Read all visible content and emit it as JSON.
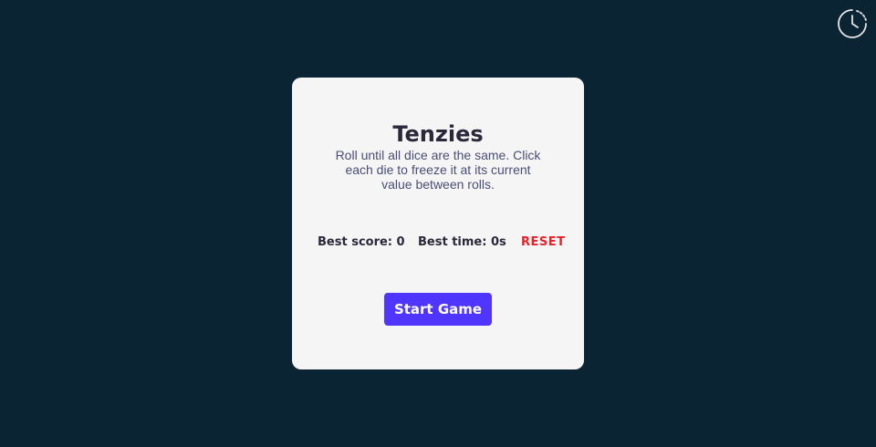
{
  "header": {
    "history_icon": "clock-history-icon"
  },
  "card": {
    "title": "Tenzies",
    "instructions": "Roll until all dice are the same. Click each die to freeze it at its current value between rolls.",
    "best_score": "Best score: 0",
    "best_time": "Best time: 0s",
    "reset_label": "RESET",
    "start_label": "Start Game"
  },
  "colors": {
    "background": "#0b2434",
    "card": "#f5f5f5",
    "accent": "#5035ff",
    "danger": "#e8202a",
    "text": "#2b283a"
  }
}
